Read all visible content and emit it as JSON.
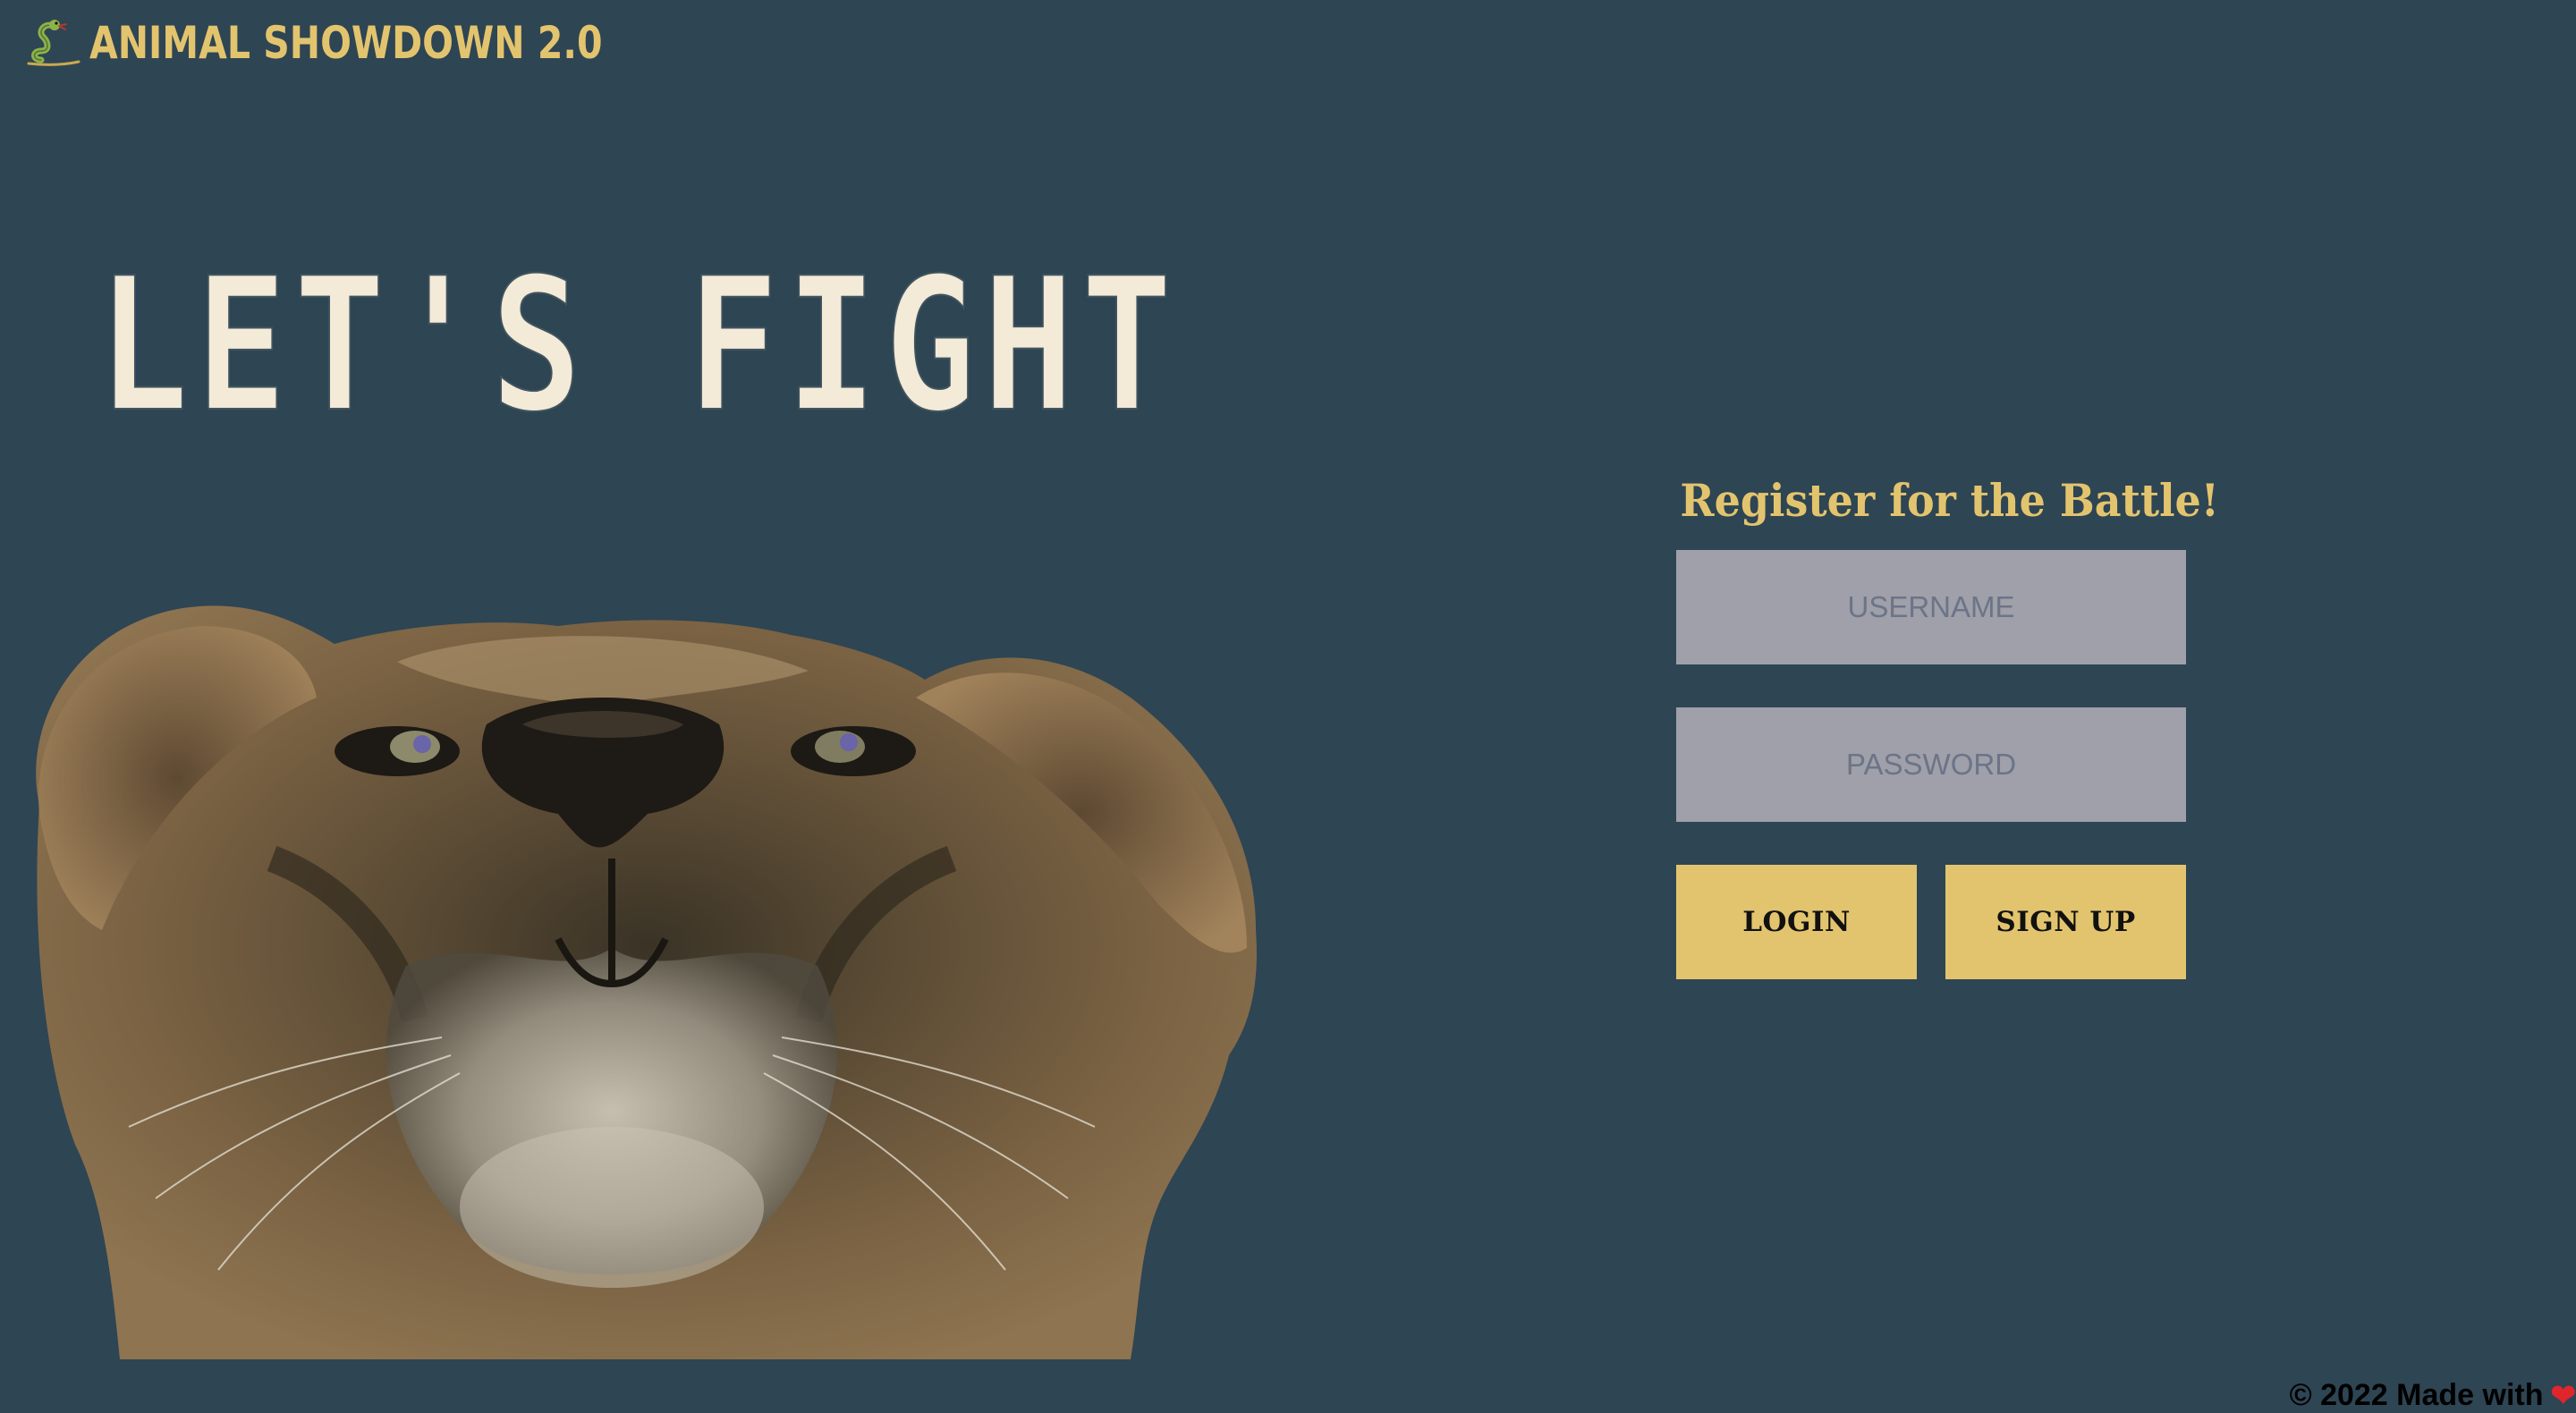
{
  "header": {
    "title": "ANIMAL SHOWDOWN 2.0",
    "logo_icon": "snake-icon"
  },
  "hero": {
    "headline": "LET'S FIGHT",
    "image_icon": "lion-face-image"
  },
  "form": {
    "title": "Register for the Battle!",
    "username_placeholder": "USERNAME",
    "username_value": "",
    "password_placeholder": "PASSWORD",
    "password_value": "",
    "login_label": "LOGIN",
    "signup_label": "SIGN UP"
  },
  "footer": {
    "text": "© 2022 Made with",
    "heart_icon": "heart-icon"
  },
  "colors": {
    "background": "#2e4553",
    "accent": "#e3c46e",
    "input_bg": "#9fa0a9",
    "headline": "#f4ead8"
  }
}
